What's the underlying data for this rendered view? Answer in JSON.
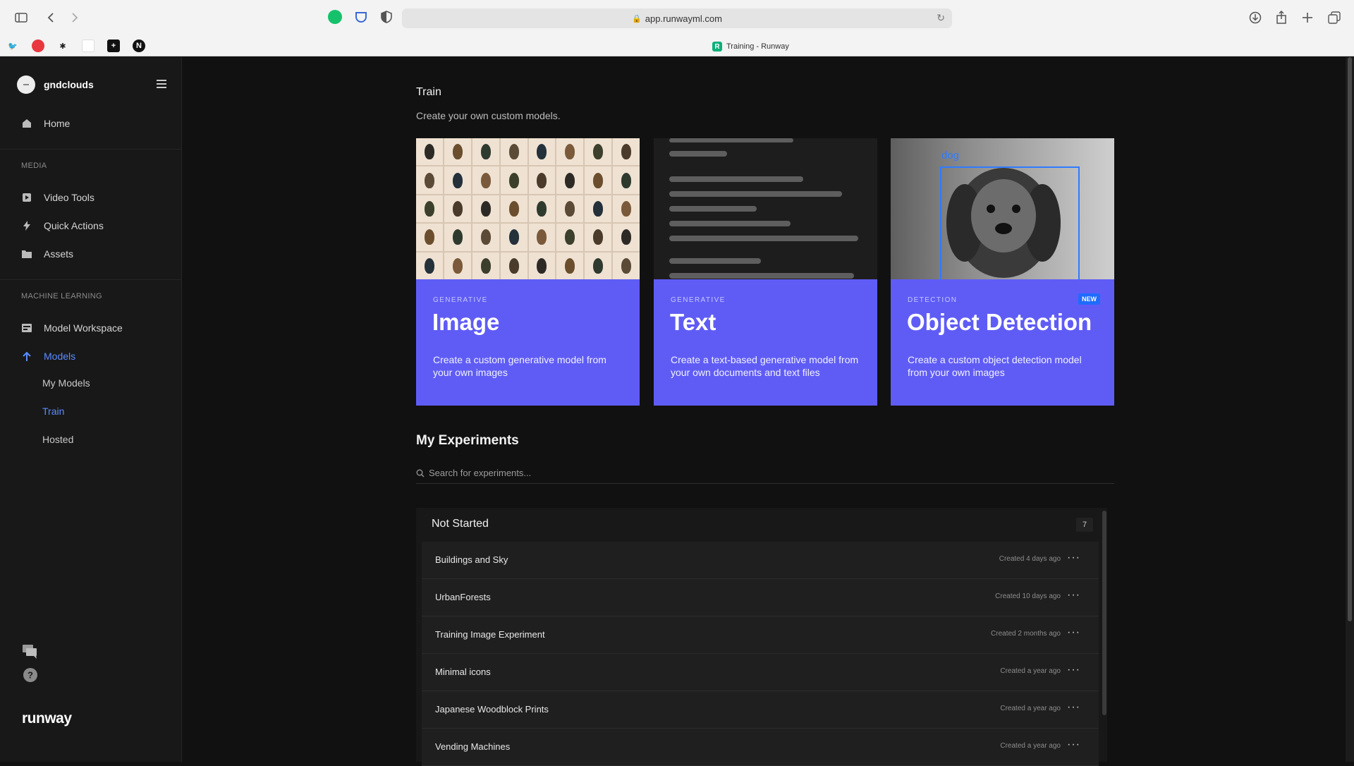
{
  "browser": {
    "url": "app.runwayml.com",
    "tab_title": "Training - Runway",
    "favicon_letters": [
      "N"
    ]
  },
  "sidebar": {
    "workspace_name": "gndclouds",
    "home_label": "Home",
    "media_section": "MEDIA",
    "media_items": [
      {
        "label": "Video Tools",
        "icon": "video-icon"
      },
      {
        "label": "Quick Actions",
        "icon": "lightning-icon"
      },
      {
        "label": "Assets",
        "icon": "folder-icon"
      }
    ],
    "ml_section": "MACHINE LEARNING",
    "ml_items": [
      {
        "label": "Model Workspace",
        "icon": "workspace-icon"
      },
      {
        "label": "Models",
        "icon": "arrow-up-icon"
      }
    ],
    "sub_items": [
      "My Models",
      "Train",
      "Hosted"
    ],
    "active_sub": "Train",
    "logo": "runway"
  },
  "main": {
    "title": "Train",
    "subtitle": "Create your own custom models.",
    "cards": [
      {
        "category": "GENERATIVE",
        "title": "Image",
        "description": "Create a custom generative model from your own images"
      },
      {
        "category": "GENERATIVE",
        "title": "Text",
        "description": "Create a text-based generative model from your own documents and text files"
      },
      {
        "category": "DETECTION",
        "title": "Object Detection",
        "description": "Create a custom object detection model from your own images",
        "badge": "NEW",
        "box_label": "dog"
      }
    ],
    "experiments_title": "My Experiments",
    "search_placeholder": "Search for experiments...",
    "group": {
      "name": "Not Started",
      "count": "7",
      "rows": [
        {
          "name": "Buildings and Sky",
          "created": "Created 4 days ago"
        },
        {
          "name": "UrbanForests",
          "created": "Created 10 days ago"
        },
        {
          "name": "Training Image Experiment",
          "created": "Created 2 months ago"
        },
        {
          "name": "Minimal icons",
          "created": "Created a year ago"
        },
        {
          "name": "Japanese Woodblock Prints",
          "created": "Created a year ago"
        },
        {
          "name": "Vending Machines",
          "created": "Created a year ago"
        }
      ],
      "more_label": "···"
    }
  },
  "colors": {
    "accent": "#5f5cf5",
    "active_link": "#5b8cff",
    "badge": "#1f6bff"
  }
}
